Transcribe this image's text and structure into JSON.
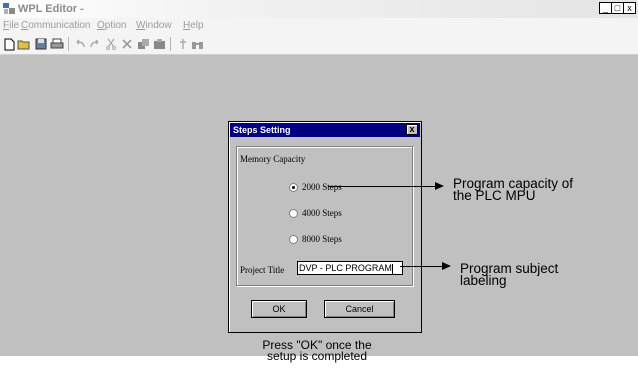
{
  "window": {
    "title": "WPL Editor -",
    "controls": [
      "_",
      "□",
      "x"
    ]
  },
  "menu": [
    {
      "label": "File",
      "accel": "F",
      "rest": "ile"
    },
    {
      "label": "Communication",
      "accel": "C",
      "rest": "ommunication"
    },
    {
      "label": "Option",
      "accel": "O",
      "rest": "ption"
    },
    {
      "label": "Window",
      "accel": "W",
      "rest": "indow"
    },
    {
      "label": "Help",
      "accel": "H",
      "rest": "elp"
    }
  ],
  "toolbar": {
    "icons": [
      "new-file-icon",
      "open-folder-icon",
      "save-icon",
      "print-icon",
      "undo-icon",
      "redo-icon",
      "cut-icon",
      "delete-icon",
      "copy-icon",
      "paste-icon",
      "find-icon",
      "binoculars-icon"
    ]
  },
  "dialog": {
    "title": "Steps Setting",
    "close": "x",
    "group_label": "Memory Capacity",
    "options": [
      {
        "label": "2000 Steps",
        "checked": true
      },
      {
        "label": "4000 Steps",
        "checked": false
      },
      {
        "label": "8000 Steps",
        "checked": false
      }
    ],
    "project_title_label": "Project Title",
    "project_title_value": "DVP - PLC PROGRAM",
    "ok_label": "OK",
    "cancel_label": "Cancel"
  },
  "annotations": {
    "capacity_line1": "Program capacity of",
    "capacity_line2": "the PLC MPU",
    "subject_line1": "Program subject",
    "subject_line2": "labeling",
    "footer_line1": "Press \"OK\" once the",
    "footer_line2": "setup is completed"
  }
}
